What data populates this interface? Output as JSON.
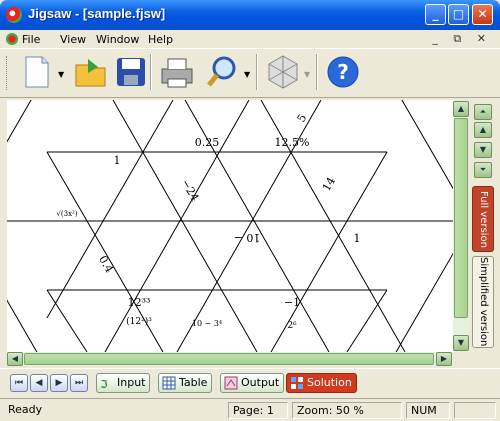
{
  "window": {
    "title": "Jigsaw - [sample.fjsw]"
  },
  "menu": {
    "file": "File",
    "view": "View",
    "window": "Window",
    "help": "Help",
    "mdi_buttons": "_ ⧉ ✕"
  },
  "toolbar": {
    "icons": [
      "new-document-icon",
      "open-folder-icon",
      "save-icon",
      "print-icon",
      "zoom-icon",
      "pattern-icon",
      "help-icon"
    ]
  },
  "puzzle": {
    "cells": [
      "0.25",
      "12.5%",
      "5",
      "1",
      "−24",
      "12³³",
      "−1",
      "10 − 3⁴",
      "1",
      "10 −",
      "2⁶",
      "(12²)³",
      "0.4",
      "14",
      "√(3x²)"
    ]
  },
  "right_tabs": {
    "full": "Full version",
    "simplified": "Simplified version"
  },
  "bottom_tabs": {
    "input": "Input",
    "table": "Table",
    "output": "Output",
    "solution": "Solution"
  },
  "status": {
    "ready": "Ready",
    "page": "Page: 1",
    "zoom": "Zoom: 50 %",
    "num": "NUM"
  }
}
